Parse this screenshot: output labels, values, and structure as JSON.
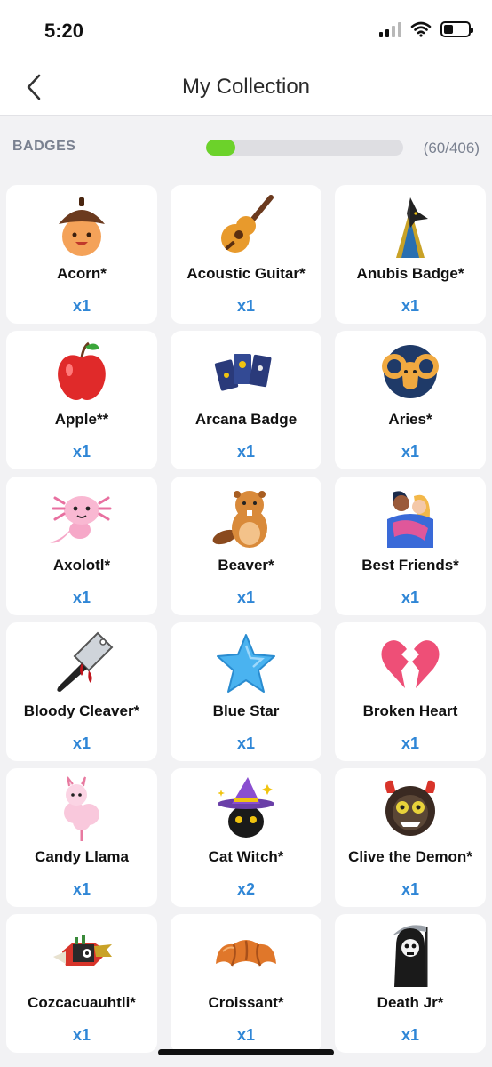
{
  "status": {
    "time": "5:20"
  },
  "nav": {
    "title": "My Collection"
  },
  "badges": {
    "label": "BADGES",
    "count_text": "(60/406)",
    "progress_fraction": 0.148
  },
  "items": [
    {
      "name": "Acorn*",
      "qty": "x1",
      "icon": "acorn-icon"
    },
    {
      "name": "Acoustic Guitar*",
      "qty": "x1",
      "icon": "guitar-icon"
    },
    {
      "name": "Anubis Badge*",
      "qty": "x1",
      "icon": "anubis-icon"
    },
    {
      "name": "Apple**",
      "qty": "x1",
      "icon": "apple-icon"
    },
    {
      "name": "Arcana Badge",
      "qty": "x1",
      "icon": "tarot-cards-icon"
    },
    {
      "name": "Aries*",
      "qty": "x1",
      "icon": "ram-icon"
    },
    {
      "name": "Axolotl*",
      "qty": "x1",
      "icon": "axolotl-icon"
    },
    {
      "name": "Beaver*",
      "qty": "x1",
      "icon": "beaver-icon"
    },
    {
      "name": "Best Friends*",
      "qty": "x1",
      "icon": "hugging-friends-icon"
    },
    {
      "name": "Bloody Cleaver*",
      "qty": "x1",
      "icon": "cleaver-icon"
    },
    {
      "name": "Blue Star",
      "qty": "x1",
      "icon": "blue-star-icon"
    },
    {
      "name": "Broken Heart",
      "qty": "x1",
      "icon": "broken-heart-icon"
    },
    {
      "name": "Candy Llama",
      "qty": "x1",
      "icon": "llama-icon"
    },
    {
      "name": "Cat Witch*",
      "qty": "x2",
      "icon": "cat-witch-icon"
    },
    {
      "name": "Clive the Demon*",
      "qty": "x1",
      "icon": "demon-icon"
    },
    {
      "name": "Cozcacuauhtli*",
      "qty": "x1",
      "icon": "aztec-vulture-icon"
    },
    {
      "name": "Croissant*",
      "qty": "x1",
      "icon": "croissant-icon"
    },
    {
      "name": "Death Jr*",
      "qty": "x1",
      "icon": "grim-reaper-icon"
    }
  ],
  "colors": {
    "accent": "#2f86d6",
    "progress": "#6cd22a",
    "background": "#f2f2f4"
  }
}
